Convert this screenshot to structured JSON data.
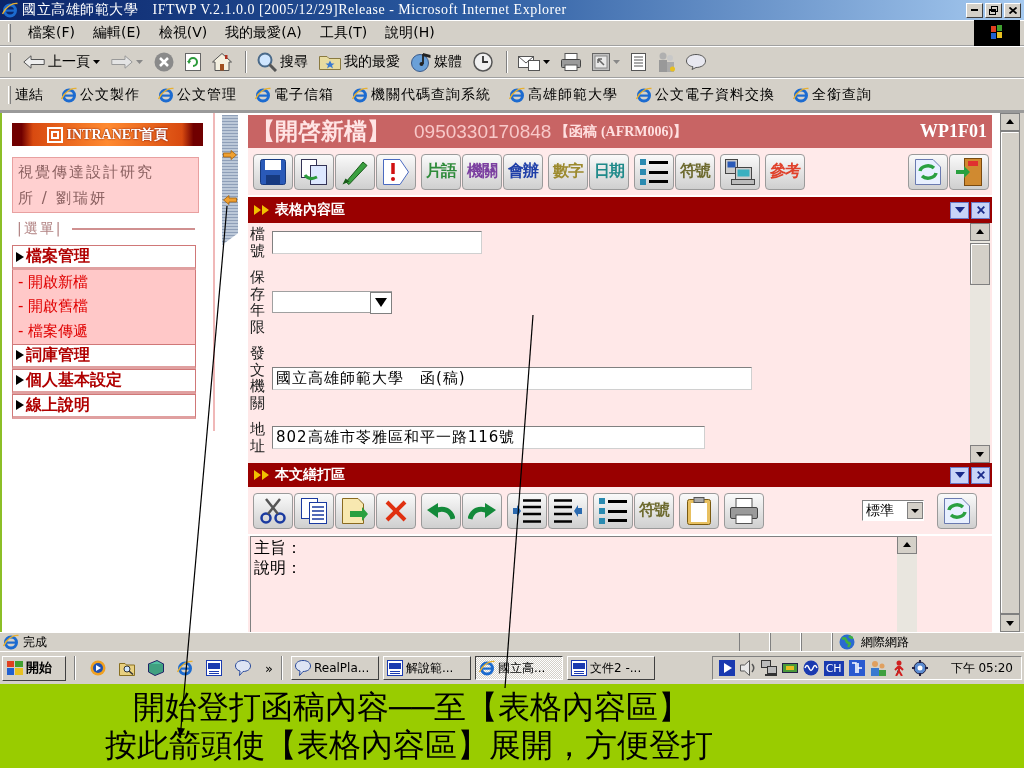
{
  "window": {
    "title": "國立高雄師範大學　IFTWP V.2.1.0.0 [2005/12/29]Release - Microsoft Internet Explorer"
  },
  "menu_bar": [
    "檔案(F)",
    "編輯(E)",
    "檢視(V)",
    "我的最愛(A)",
    "工具(T)",
    "說明(H)"
  ],
  "toolbar": {
    "back": "上一頁",
    "search": "搜尋",
    "favorites": "我的最愛",
    "media": "媒體"
  },
  "links_bar": {
    "label": "連結",
    "links": [
      "公文製作",
      "公文管理",
      "電子信箱",
      "機關代碼查詢系統",
      "高雄師範大學",
      "公文電子資料交換",
      "全銜查詢"
    ]
  },
  "sidebar": {
    "banner": "INTRANET首頁",
    "user": "視覺傳達設計研究所 / 劉瑞妍",
    "menu_label": "|選單|",
    "menu": [
      {
        "label": "檔案管理",
        "children": [
          {
            "label": "- 開啟新檔"
          },
          {
            "label": "- 開啟舊檔"
          },
          {
            "label": "- 檔案傳遞"
          }
        ]
      },
      {
        "label": "詞庫管理"
      },
      {
        "label": "個人基本設定"
      },
      {
        "label": "線上說明"
      }
    ]
  },
  "document": {
    "title": "【開啓新檔】",
    "number": "0950330170848",
    "type": "【函稿 (AFRM006)】",
    "code": "WP1F01",
    "toolbar": [
      "片語",
      "機關",
      "會辦",
      "數字",
      "日期",
      "符號",
      "參考"
    ],
    "form_section": {
      "title": "表格內容區",
      "fields": [
        {
          "label": "檔號",
          "kind": "text"
        },
        {
          "label": "保存年限",
          "kind": "select"
        },
        {
          "label": "發文機關",
          "kind": "text",
          "value": "國立高雄師範大學　函(稿)"
        },
        {
          "label": "地址",
          "kind": "text",
          "value": "802高雄市苓雅區和平一路116號"
        }
      ]
    },
    "body_section": {
      "title": "本文繕打區",
      "toolbar": [
        "符號"
      ],
      "style_select": "標準",
      "lines": [
        "主旨：",
        "說明："
      ]
    }
  },
  "status_bar": {
    "text": "完成",
    "zone": "網際網路"
  },
  "taskbar": {
    "start": "開始",
    "more": "»",
    "tasks": [
      {
        "label": "RealPla...",
        "selected": false
      },
      {
        "label": "解說範...",
        "selected": false
      },
      {
        "label": "國立高...",
        "selected": true
      },
      {
        "label": "文件2 -...",
        "selected": false
      }
    ],
    "language": "CH",
    "clock": "下午 05:20"
  },
  "caption": [
    "開始登打函稿內容──至【表格內容區】",
    "按此箭頭使【表格內容區】展開，方便登打"
  ]
}
